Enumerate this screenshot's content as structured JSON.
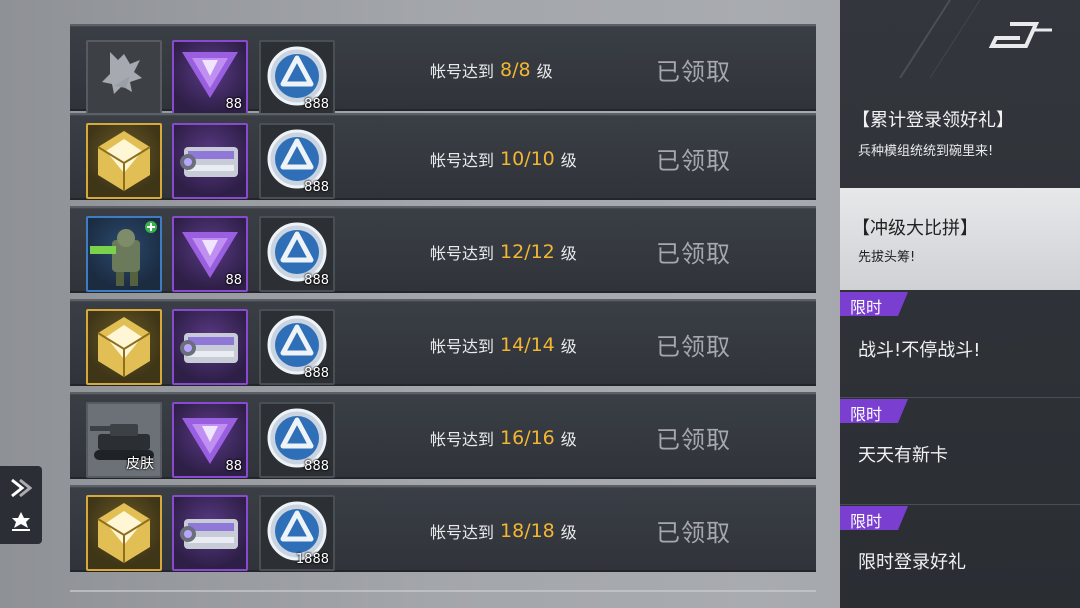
{
  "rows": [
    {
      "prefix": "帐号达到",
      "level": "8/8",
      "suffix": "级",
      "status": "已领取",
      "slot1": "special-icon",
      "slot2_qty": "88",
      "slot3_qty": "888"
    },
    {
      "prefix": "帐号达到",
      "level": "10/10",
      "suffix": "级",
      "status": "已领取",
      "slot1": "gold-crate-icon",
      "slot2_qty": "",
      "slot3_qty": "888"
    },
    {
      "prefix": "帐号达到",
      "level": "12/12",
      "suffix": "级",
      "status": "已领取",
      "slot1": "unit-card-icon",
      "slot2_qty": "88",
      "slot3_qty": "888"
    },
    {
      "prefix": "帐号达到",
      "level": "14/14",
      "suffix": "级",
      "status": "已领取",
      "slot1": "gold-crate-icon",
      "slot2_qty": "",
      "slot3_qty": "888"
    },
    {
      "prefix": "帐号达到",
      "level": "16/16",
      "suffix": "级",
      "status": "已领取",
      "slot1": "tank-skin-icon",
      "slot1_label": "皮肤",
      "slot2_qty": "88",
      "slot3_qty": "888"
    },
    {
      "prefix": "帐号达到",
      "level": "18/18",
      "suffix": "级",
      "status": "已领取",
      "slot1": "gold-crate-icon",
      "slot2_qty": "",
      "slot3_qty": "1888"
    }
  ],
  "sidebar": {
    "items": [
      {
        "title": "【累计登录领好礼】",
        "subtitle": "兵种模组统统到碗里来!"
      },
      {
        "title": "【冲级大比拼】",
        "subtitle": "先拔头筹!"
      },
      {
        "badge": "限时",
        "title": "战斗!不停战斗!"
      },
      {
        "badge": "限时",
        "title": "天天有新卡"
      },
      {
        "badge": "限时",
        "title": "限时登录好礼"
      }
    ]
  },
  "colors": {
    "level": "#f3b632",
    "badge": "#7a3fd0",
    "gold_frame": "#d6a93a",
    "purple_frame": "#8a4ad0"
  }
}
